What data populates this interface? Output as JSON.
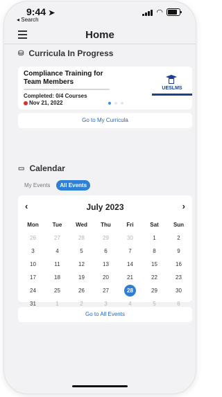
{
  "status": {
    "time": "9:44",
    "back_label": "◂ Search"
  },
  "nav": {
    "title": "Home"
  },
  "curricula": {
    "heading": "Curricula In Progress",
    "card": {
      "title": "Compliance Training for Team Members",
      "completed": "Completed: 0/4 Courses",
      "progress": 0,
      "date": "Nov 21, 2022",
      "logo_text": "UESLMS"
    },
    "button_label": "Go to My Curricula"
  },
  "calendar": {
    "heading": "Calendar",
    "tabs": [
      {
        "label": "My Events",
        "active": false
      },
      {
        "label": "All Events",
        "active": true
      }
    ],
    "month": "July 2023",
    "prev": "‹",
    "next": "›",
    "weekdays": [
      "Mon",
      "Tue",
      "Wed",
      "Thu",
      "Fri",
      "Sat",
      "Sun"
    ],
    "weeks": [
      [
        "26",
        "27",
        "28",
        "29",
        "30",
        "1",
        "2"
      ],
      [
        "3",
        "4",
        "5",
        "6",
        "7",
        "8",
        "9"
      ],
      [
        "10",
        "11",
        "12",
        "13",
        "14",
        "15",
        "16"
      ],
      [
        "17",
        "18",
        "19",
        "20",
        "21",
        "22",
        "23"
      ],
      [
        "24",
        "25",
        "26",
        "27",
        "28",
        "29",
        "30"
      ],
      [
        "31",
        "1",
        "2",
        "3",
        "4",
        "5",
        "6"
      ]
    ],
    "selected": "28",
    "button_label": "Go to All Events"
  }
}
